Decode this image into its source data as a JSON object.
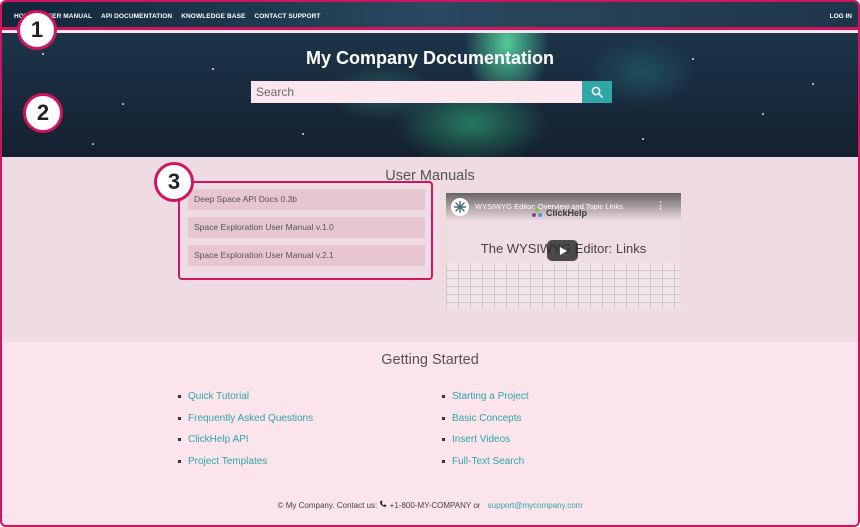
{
  "nav": {
    "items": [
      "HOME",
      "USER MANUAL",
      "API DOCUMENTATION",
      "KNOWLEDGE BASE",
      "CONTACT SUPPORT"
    ],
    "login": "LOG IN"
  },
  "hero": {
    "title": "My Company Documentation",
    "search_placeholder": "Search",
    "search_icon": "search-icon"
  },
  "manuals": {
    "title": "User Manuals",
    "items": [
      "Deep Space API Docs 0.3b",
      "Space Exploration User Manual v.1.0",
      "Space Exploration User Manual v.2.1"
    ]
  },
  "video": {
    "title": "WYSIWYG Editor: Overview and Topic Links",
    "logo_text": "ClickHelp",
    "headline": "The WYSIWYG Editor: Links"
  },
  "getting_started": {
    "title": "Getting Started",
    "left": [
      "Quick Tutorial",
      "Frequently Asked Questions",
      "ClickHelp API",
      "Project Templates"
    ],
    "right": [
      "Starting a Project",
      "Basic Concepts",
      "Insert Videos",
      "Full-Text Search"
    ]
  },
  "footer": {
    "text": "© My Company. Contact us: ",
    "phone": "+1-800-MY-COMPANY or",
    "email": "support@mycompany.com"
  },
  "callouts": [
    "1",
    "2",
    "3"
  ],
  "colors": {
    "accent": "#d0155f",
    "teal": "#2fa6a8"
  }
}
